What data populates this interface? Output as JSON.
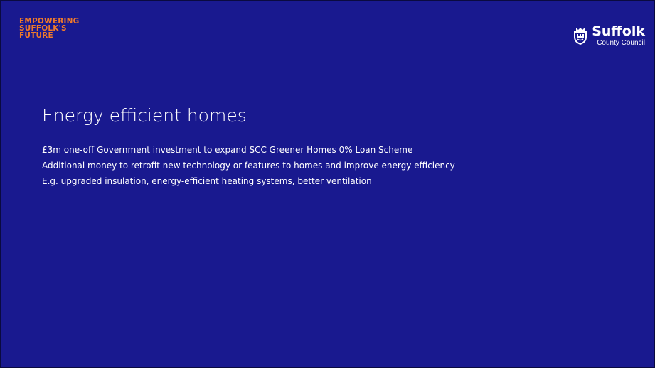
{
  "branding": {
    "tagline_lines": [
      "EMPOWERING",
      "SUFFOLK'S",
      "FUTURE"
    ],
    "tagline_color": "#f07a2a",
    "logo": {
      "icon": "suffolk-crest-icon",
      "name": "Suffolk",
      "subtitle": "County Council"
    }
  },
  "slide": {
    "background": "#19198f",
    "title": "Energy efficient homes",
    "bullets": [
      "£3m one-off Government investment to expand SCC Greener Homes 0% Loan Scheme",
      "Additional money to retrofit new technology or features to homes and improve energy efficiency",
      "E.g. upgraded insulation, energy-efficient heating systems, better ventilation"
    ]
  }
}
